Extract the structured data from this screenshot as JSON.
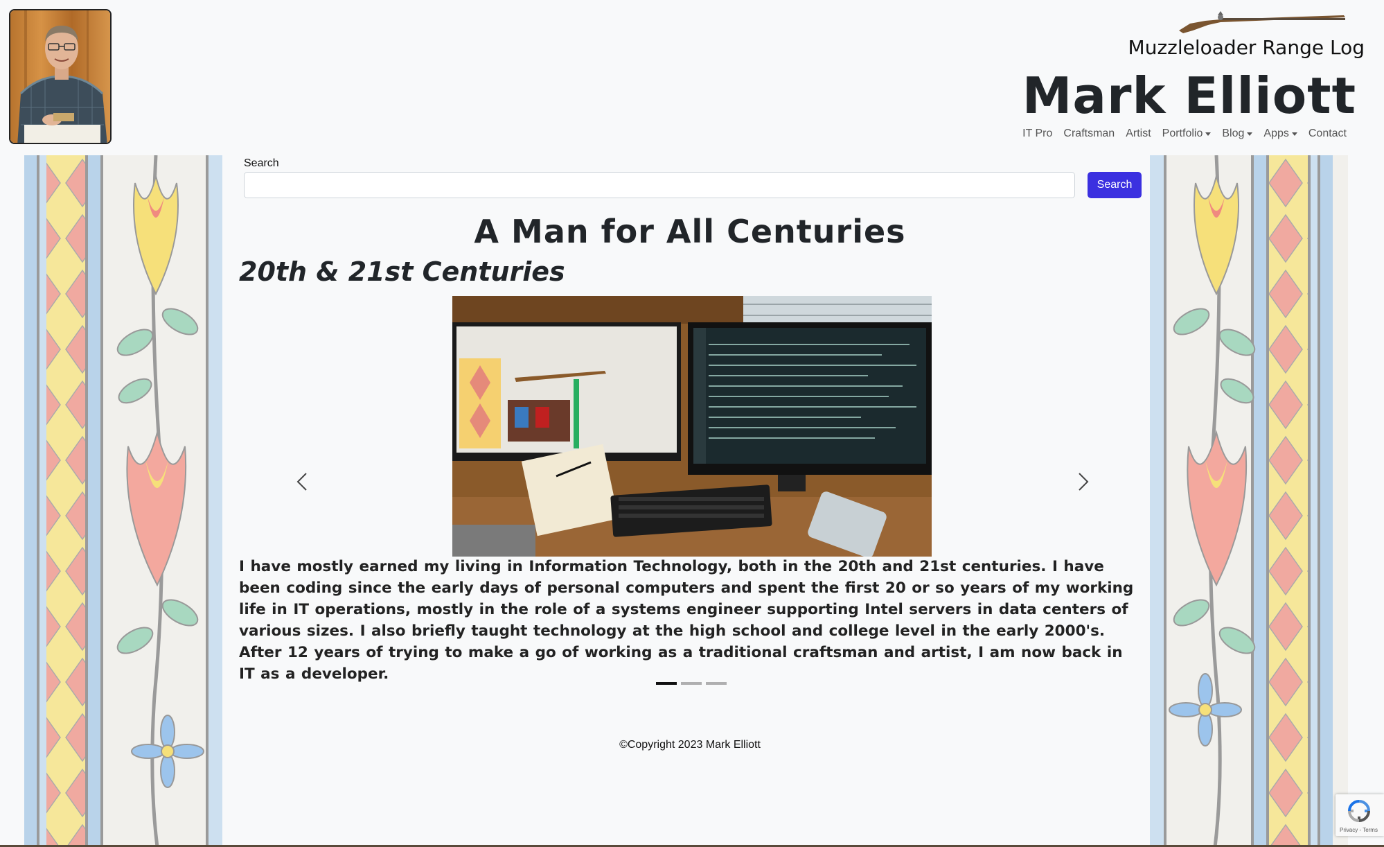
{
  "header": {
    "subtitle": "Muzzleloader Range Log",
    "title": "Mark Elliott",
    "nav": [
      {
        "label": "IT Pro",
        "dropdown": false
      },
      {
        "label": "Craftsman",
        "dropdown": false
      },
      {
        "label": "Artist",
        "dropdown": false
      },
      {
        "label": "Portfolio",
        "dropdown": true
      },
      {
        "label": "Blog",
        "dropdown": true
      },
      {
        "label": "Apps",
        "dropdown": true
      },
      {
        "label": "Contact",
        "dropdown": false
      }
    ]
  },
  "search": {
    "label": "Search",
    "value": "",
    "button_label": "Search"
  },
  "main": {
    "heading": "A Man for All Centuries",
    "section_heading": "20th & 21st Centuries",
    "carousel": {
      "caption": "I have mostly earned my living in Information Technology, both in the 20th and 21st centuries. I have been coding since the early days of personal computers and spent the first 20 or so years of my working life in IT operations, mostly in the role of a systems engineer supporting Intel servers in data centers of various sizes. I also briefly taught technology at the high school and college level in the early 2000's. After 12 years of trying to make a go of working as a traditional craftsman and artist, I am now back in IT as a developer.",
      "slide_count": 3,
      "active_index": 0
    }
  },
  "footer": {
    "copyright": "©Copyright 2023 Mark Elliott"
  },
  "recaptcha": {
    "text": "Privacy - Terms"
  },
  "colors": {
    "accent": "#3b30e0",
    "background": "#f8f9fa"
  }
}
